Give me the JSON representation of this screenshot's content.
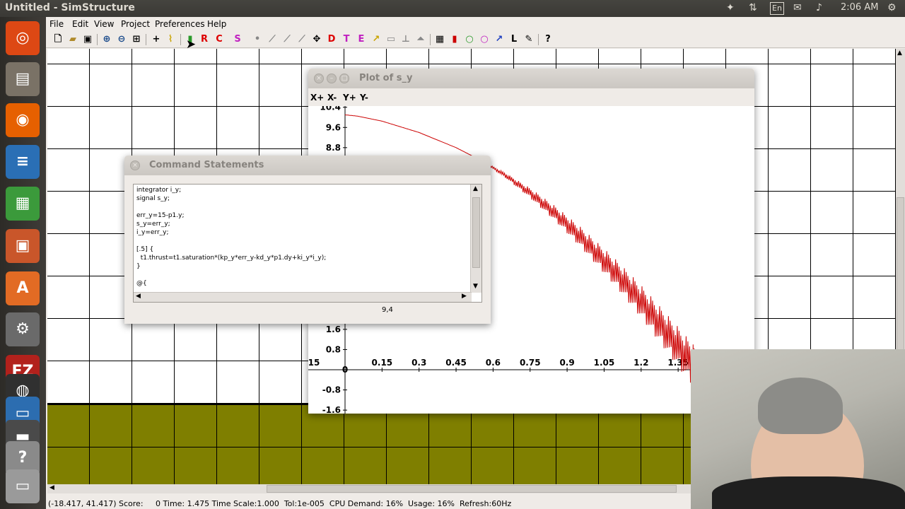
{
  "topbar": {
    "title": "Untitled - SimStructure",
    "keyboard_layout": "En",
    "clock": "2:06 AM"
  },
  "launcher": {
    "items": [
      {
        "name": "ubuntu-dash",
        "glyph": "◎",
        "color": "#dd4814"
      },
      {
        "name": "files",
        "glyph": "▤",
        "color": "#7a7266"
      },
      {
        "name": "firefox",
        "glyph": "◉",
        "color": "#e66000"
      },
      {
        "name": "libreoffice-writer",
        "glyph": "≡",
        "color": "#2a6fb5"
      },
      {
        "name": "libreoffice-calc",
        "glyph": "▦",
        "color": "#3b9a3b"
      },
      {
        "name": "libreoffice-impress",
        "glyph": "▣",
        "color": "#c9562a"
      },
      {
        "name": "software-center",
        "glyph": "A",
        "color": "#e26b24"
      },
      {
        "name": "system-settings",
        "glyph": "⚙",
        "color": "#6a6a6a"
      },
      {
        "name": "filezilla",
        "glyph": "FZ",
        "color": "#b2211c"
      },
      {
        "name": "obs",
        "glyph": "◍",
        "color": "#303030"
      },
      {
        "name": "screen-recorder",
        "glyph": "▭",
        "color": "#2c6db0"
      },
      {
        "name": "terminal",
        "glyph": "▬",
        "color": "#4a4a4a"
      },
      {
        "name": "help",
        "glyph": "?",
        "color": "#8a8a8a"
      },
      {
        "name": "disk-drive",
        "glyph": "▭",
        "color": "#9a9a9a"
      }
    ]
  },
  "menubar": {
    "file": "File",
    "edit": "Edit",
    "view": "View",
    "project": "Project",
    "preferences": "Preferences",
    "help": "Help"
  },
  "toolbar": {
    "tool_r": "R",
    "tool_c": "C",
    "tool_s": "S",
    "tool_d": "D",
    "tool_t": "T",
    "tool_e": "E",
    "tool_l": "L",
    "tool_help": "?"
  },
  "statusbar": {
    "text": "(-18.417, 41.417) Score:     0 Time: 1.475 Time Scale:1.000  Tol:1e-005  CPU Demand: 16%  Usage: 16%  Refresh:60Hz"
  },
  "plot_window": {
    "title": "Plot of s_y",
    "buttons": [
      "X+",
      "X-",
      "Y+",
      "Y-"
    ]
  },
  "chart_data": {
    "type": "line",
    "title": "",
    "xlabel": "",
    "ylabel": "",
    "x_ticks": [
      0.15,
      0.3,
      0.45,
      0.6,
      0.75,
      0.9,
      1.05,
      1.2,
      1.35
    ],
    "y_ticks": [
      10.4,
      9.6,
      8.8,
      1.6,
      0.8,
      0,
      -0.8,
      -1.6
    ],
    "clipped_tick_labels": {
      "x_left": "15"
    },
    "xlim": [
      -0.15,
      1.43
    ],
    "ylim": [
      -1.75,
      10.75
    ],
    "line_color": "#cc0000",
    "series": [
      {
        "x": [
          0,
          0.05,
          0.1,
          0.15,
          0.2,
          0.25,
          0.3,
          0.35,
          0.4,
          0.45,
          0.5,
          0.55,
          0.6,
          0.65,
          0.7,
          0.75,
          0.8,
          0.85,
          0.9,
          0.95,
          1.0,
          1.05,
          1.1,
          1.15,
          1.2,
          1.25,
          1.3,
          1.35,
          1.4,
          1.43
        ],
        "values": [
          10.1,
          10.05,
          9.95,
          9.85,
          9.7,
          9.55,
          9.4,
          9.2,
          9.0,
          8.8,
          8.55,
          8.3,
          8.0,
          7.7,
          7.35,
          7.0,
          6.6,
          6.2,
          5.75,
          5.3,
          4.8,
          4.3,
          3.8,
          3.25,
          2.7,
          2.1,
          1.5,
          0.9,
          0.3,
          0.0
        ]
      }
    ]
  },
  "command_window": {
    "title": "Command Statements",
    "lines": [
      "integrator i_y;",
      "signal s_y;",
      "",
      "err_y=15-p1.y;",
      "s_y=err_y;",
      "i_y=err_y;",
      "",
      "[.5] {",
      "  t1.thrust=t1.saturation*(kp_y*err_y-kd_y*p1.dy+ki_y*i_y);",
      "}",
      "",
      "@{"
    ],
    "cursor_position": "9,4"
  }
}
